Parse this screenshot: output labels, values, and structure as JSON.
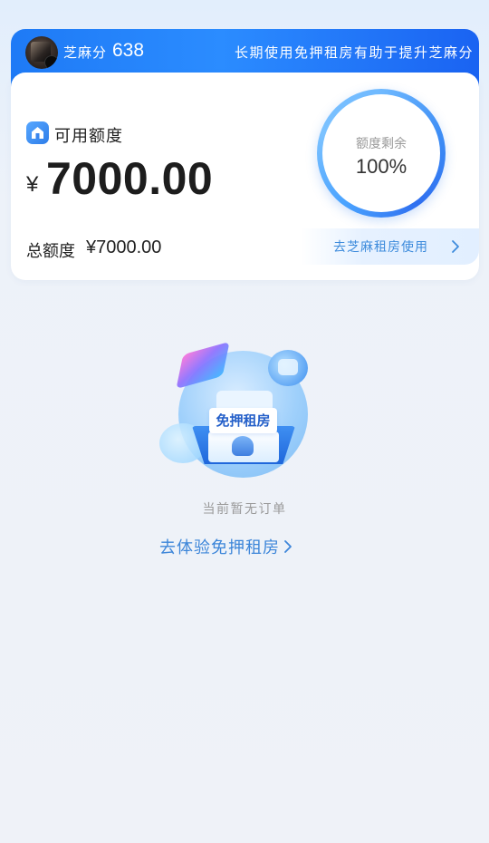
{
  "banner": {
    "score_label": "芝麻分",
    "score": "638",
    "tip": "长期使用免押租房有助于提升芝麻分",
    "colors": {
      "start": "#1e7af6",
      "end": "#1a63f2"
    }
  },
  "credit": {
    "available_label": "可用额度",
    "currency": "¥",
    "available_amount": "7000.00",
    "ring_label": "额度剩余",
    "ring_value": "100%",
    "ring_progress": 1.0,
    "total_label": "总额度",
    "total_amount": "¥7000.00",
    "use_link": "去芝麻租房使用"
  },
  "empty_state": {
    "illustration_tag": "免押租房",
    "message": "当前暂无订单",
    "action": "去体验免押租房"
  },
  "icons": {
    "house": "house-icon",
    "chevron": "chevron-right-icon"
  },
  "colors": {
    "accent": "#3d86d9",
    "text_primary": "#222222",
    "text_muted": "#9a9a9a"
  }
}
